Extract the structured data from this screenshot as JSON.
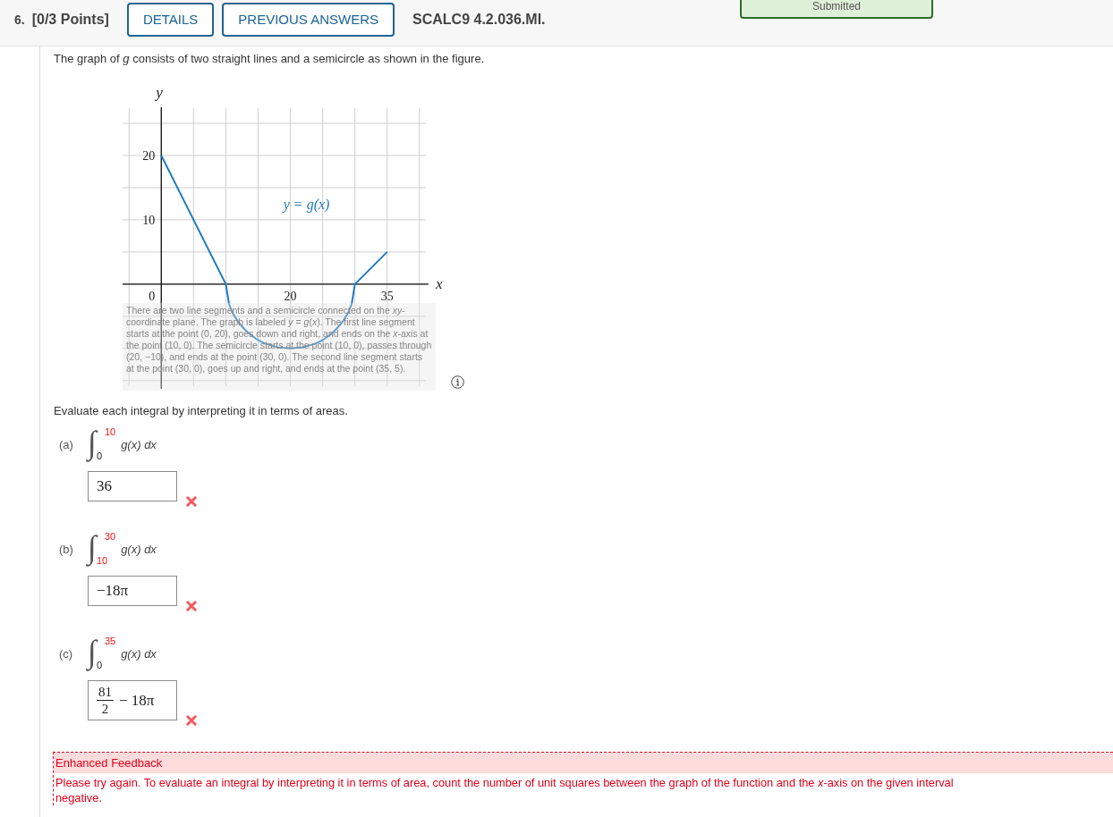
{
  "header": {
    "number": "6.",
    "points": "[0/3 Points]",
    "buttons": [
      "DETAILS",
      "PREVIOUS ANSWERS"
    ],
    "code": "SCALC9 4.2.036.MI.",
    "status": "Submitted"
  },
  "prompt": "The graph of *g* consists of two straight lines and a semicircle as shown in the figure.",
  "figure": {
    "description": "There are two line segments and a semicircle connected on the *xy*-coordinate plane. The graph is labeled *y* = *g*(*x*). The first line segment starts at the point (0, 20), goes down and right, and ends on the *x*-axis at the point (10, 0). The semicircle starts at the point (10, 0), passes through (20, −10), and ends at the point (30, 0). The second line segment starts at the point (30, 0), goes up and right, and ends at the point (35, 5).",
    "chart_data": {
      "type": "line",
      "xlabel": "x",
      "ylabel": "y",
      "x": [
        0,
        5,
        10,
        10.5,
        11,
        12,
        13,
        14,
        15,
        16,
        17,
        18,
        19,
        20,
        21,
        22,
        23,
        24,
        25,
        26,
        27,
        28,
        29,
        29.5,
        30,
        35
      ],
      "series": [
        {
          "name": "y = g(x)",
          "color": "#1f7bc1",
          "values": [
            20,
            10,
            0,
            -3.1,
            -4.4,
            -6,
            -7.1,
            -8,
            -8.7,
            -9.2,
            -9.5,
            -9.8,
            -9.9,
            -10,
            -9.9,
            -9.8,
            -9.5,
            -9.2,
            -8.7,
            -8,
            -7.1,
            -6,
            -4.4,
            -3.1,
            0,
            5
          ]
        }
      ],
      "xlim": [
        -6,
        41
      ],
      "ylim": [
        -16,
        27.5
      ],
      "xticks": [
        0,
        20,
        35
      ],
      "yticks": [
        10,
        20
      ],
      "grid": true
    }
  },
  "instruction": "Evaluate each integral by interpreting it in terms of areas.",
  "parts": [
    {
      "label": "(a)",
      "sign": "∫",
      "upper": {
        "text": "10",
        "highlighted": true
      },
      "lower": {
        "text": "0",
        "highlighted": false
      },
      "integrand": "g(x) dx",
      "answer": {
        "kind": "plain",
        "text": "36"
      },
      "correct": false
    },
    {
      "label": "(b)",
      "sign": "∫",
      "upper": {
        "text": "30",
        "highlighted": true
      },
      "lower": {
        "text": "10",
        "highlighted": true
      },
      "integrand": "g(x) dx",
      "answer": {
        "kind": "plain",
        "text": "−18π"
      },
      "correct": false
    },
    {
      "label": "(c)",
      "sign": "∫",
      "upper": {
        "text": "35",
        "highlighted": true
      },
      "lower": {
        "text": "0",
        "highlighted": false
      },
      "integrand": "g(x) dx",
      "answer": {
        "kind": "fraction",
        "numerator": "81",
        "denominator": "2",
        "rest": "− 18π"
      },
      "correct": false
    }
  ],
  "feedback": {
    "title": "Enhanced Feedback",
    "lines": [
      "Please try again. To evaluate an integral by interpreting it in terms of area, count the number of unit squares between the graph of the function and the *x*-axis on the given interval",
      "negative."
    ]
  }
}
